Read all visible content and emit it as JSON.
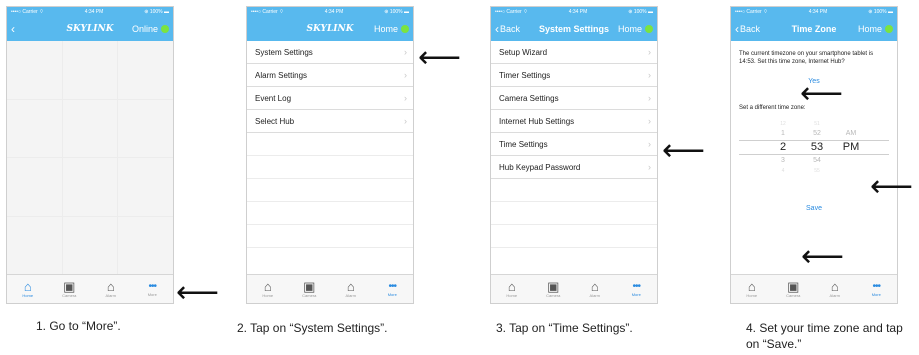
{
  "statusbar": {
    "carrier": "••••○ Carrier ⌔",
    "time": "4:34 PM",
    "battery": "⊕ 100% ▬"
  },
  "phone1": {
    "logo": "SKYLINK",
    "online_label": "Online",
    "tabs": [
      {
        "icon": "house-icon",
        "glyph": "⌂",
        "label": "Home"
      },
      {
        "icon": "camera-icon",
        "glyph": "▣",
        "label": "Camera"
      },
      {
        "icon": "alarm-icon",
        "glyph": "⌂",
        "label": "Alarm"
      },
      {
        "icon": "more-icon",
        "glyph": "•••",
        "label": "More"
      }
    ]
  },
  "phone2": {
    "logo": "SKYLINK",
    "home_label": "Home",
    "menu": [
      "System Settings",
      "Alarm Settings",
      "Event Log",
      "Select Hub"
    ],
    "tabs": [
      {
        "label": "Home"
      },
      {
        "label": "Camera"
      },
      {
        "label": "Alarm"
      },
      {
        "label": "More"
      }
    ]
  },
  "phone3": {
    "back_label": "Back",
    "title": "System Settings",
    "home_label": "Home",
    "menu": [
      "Setup Wizard",
      "Timer Settings",
      "Camera Settings",
      "Internet Hub Settings",
      "Time Settings",
      "Hub Keypad Password"
    ]
  },
  "phone4": {
    "back_label": "Back",
    "title": "Time Zone",
    "home_label": "Home",
    "question": "The current timezone on your smartphone tablet is 14:53. Set this time zone, Internet Hub?",
    "yes_label": "Yes",
    "set_label": "Set a different time zone:",
    "picker": {
      "hours": [
        "12",
        "1",
        "2",
        "3",
        "4"
      ],
      "minutes": [
        "51",
        "52",
        "53",
        "54",
        "55"
      ],
      "ampm": [
        "AM",
        "PM"
      ]
    },
    "save_label": "Save"
  },
  "captions": [
    "1. Go to “More”.",
    "2. Tap on “System Settings”.",
    "3. Tap  on “Time Settings”.",
    "4. Set your time zone and tap on “Save.”"
  ],
  "pointer_glyph": "⟵"
}
